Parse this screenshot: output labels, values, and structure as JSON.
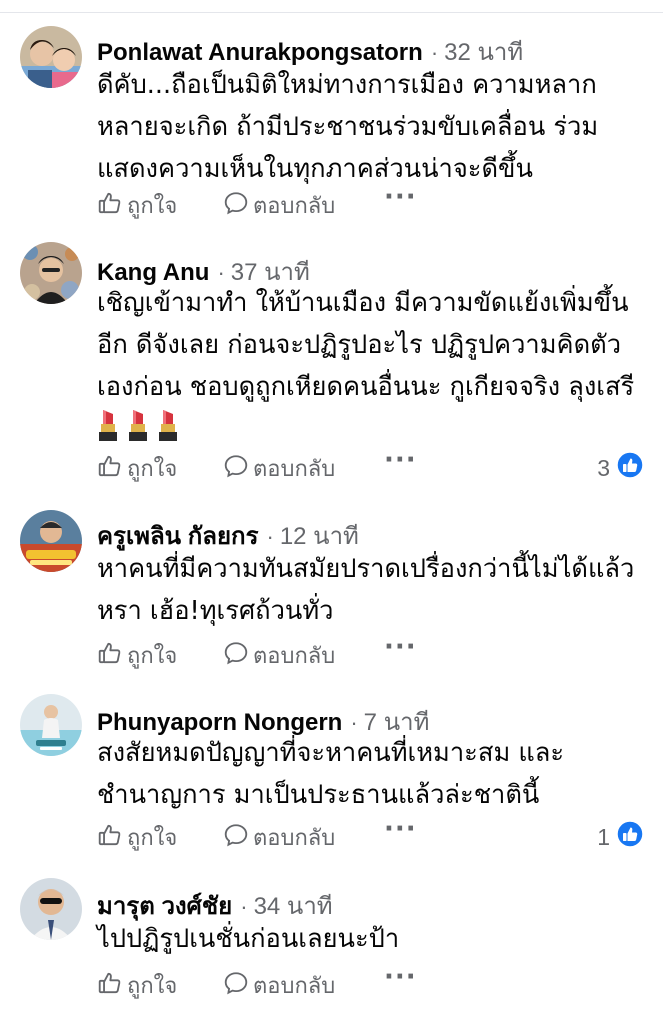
{
  "comments": [
    {
      "author": "Ponlawat Anurakpongsatorn",
      "time": "32 นาที",
      "lines": [
        "ดีคับ...ถือเป็นมิติใหม่ทางการเมือง ความหลาก",
        "หลายจะเกิด ถ้ามีประชาชนร่วมขับเคลื่อน ร่วม",
        "แสดงความเห็นในทุกภาคส่วนน่าจะดีขึ้น"
      ],
      "reactions": null
    },
    {
      "author": "Kang Anu",
      "time": "37 นาที",
      "lines": [
        "เชิญเข้ามาทำ ให้บ้านเมือง มีความขัดแย้งเพิ่มขึ้น",
        "อีก ดีจังเลย ก่อนจะปฏิรูปอะไร ปฏิรูปความคิดตัว",
        "เองก่อน ชอบดูถูกเหียดคนอื่นนะ กูเกียจจริง ลุงเสรี"
      ],
      "emoji": [
        "lipstick",
        "lipstick",
        "lipstick"
      ],
      "reactions": "3"
    },
    {
      "author": "ครูเพลิน กัลยกร",
      "time": "12 นาที",
      "lines": [
        "หาคนที่มีความทันสมัยปราดเปรื่องกว่านี้ไม่ได้แล้ว",
        "หรา เฮ้อ!ทุเรศถ้วนทั่ว"
      ],
      "reactions": null
    },
    {
      "author": "Phunyaporn Nongern",
      "time": "7 นาที",
      "lines": [
        "สงสัยหมดปัญญาที่จะหาคนที่เหมาะสม และ",
        "ชำนาญการ มาเป็นประธานแล้วล่ะชาตินี้"
      ],
      "reactions": "1"
    },
    {
      "author": "มารุต วงศ์ชัย",
      "time": "34 นาที",
      "lines": [
        "ไปปฏิรูปเนชั่นก่อนเลยนะป้า"
      ],
      "reactions": null
    }
  ],
  "actions": {
    "like": "ถูกใจ",
    "reply": "ตอบกลับ",
    "more": "···"
  },
  "icons": {
    "like": "thumbs-up-icon",
    "reply": "speech-bubble-icon",
    "reaction": "like-reaction-icon"
  },
  "colors": {
    "muted": "#65676b",
    "text": "#050505",
    "facebook_blue": "#1877f2"
  }
}
